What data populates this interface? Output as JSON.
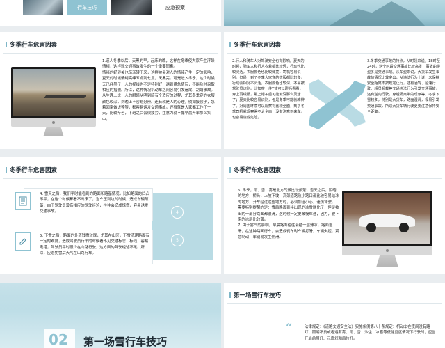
{
  "top_left": {
    "tab_active": "行车技巧",
    "tab_other": "应急预案"
  },
  "slide2": {
    "title": "冬季行车危害因素",
    "paragraph": "1.道人冬季以后，天黑的早，起床的晚，这样在冬季使大家产生浮躁情绪，这样就交通事故发生的一个重要因素。\n情绪的好转关也渐渐转下来，这样被会对人的情绪产生一定的影响，夏天的时候情绪高峰五点到七点，天黑完。可是进入冬季，这个时候天已经黑了，人的视线也不是特别好，遇到紧急情况，不能及时采取相应的措施。所以，这种情况机动车之间容易引发追尾、刮蹭事故。\n从生理上说，人的眼睛从明到暗有个适应的过程，尤其冬季穿的衣服颜色较深，到晚上不容易分辨。还有就是人的心理，例如接孩子，急着回家做饭等等，都容易诱发交通事故。还有就是大家都工作了一天，比较辛苦，下班之后会很疲劳，注意力就不像早晨开车那么集中。"
  },
  "slide3": {
    "title": "冬季行车危害因素",
    "left_text": "2.行人和骑车人对驾驶安全也有影响。夏天的时候，骑车人和行人衣着都比较轻，行动也比较灵活，衣服颜色也比较鲜亮，司机容易识别。但是一到了冬季大家穿的衣服都比较多，行动会相对不灵活，衣服颜色也较深，不易被驾驶员识别。比如穿一件T恤可以蹬后看看，穿上羽绒服，戴上帽子后可能就没那么灵活了；夏天比较容易识别，但是冬季可能就难辨了。对周围环境可以观察得比较全面，到了冬季司机就观察得不太全面，没有注意到来车，也容易造成危险。",
    "right_text": "3.冬季交通事故的特点，从时段来说，18时至24时，这个时段交通事故比较高发，事故的类型多是交通事故。从车型来说，大货车发生事故的情况比较突出，从违法行为上说，未保持安全距离不按规定让行，还有酒驾、超速行驶、超员超载等交通违法行为引发交通事故，还有逆向行驶，穿越隔离带的现象等，冬季下雪较多，特别是大货车，路面湿滑，极易引发交通事故，所以大货车辆行驶更要注意保持安全距离。"
  },
  "slide4": {
    "title": "冬季行车危害因素",
    "item4": "4. 雪天之后，我们平时能看到的路面和路基情况，比如路面的凹凸不平，在这个时候都看不出来了，当车压到坑的时候，造成车辆颠簸，由于驾驶员没有相应的驾驶经验，往往会造成惊慌，容易诱发交通事故。",
    "item5": "5. 下雪之后，路面的外道残雪较厚，尤其在山区，下雪清理路面有一定的难度，造成驾驶员行车的时候看不见交通标志、标线，容易走错，驾驶员平时很少在山路行驶，这方面的驾驶经验不足。所以，应避免雪后天气在山路行车。",
    "num_a": "4",
    "num_b": "5"
  },
  "slide5": {
    "title": "冬季行车危害因素",
    "paragraph": "6. 冬季，雨、雪、雾是北方气候比较频繁，雪天之后，阴暗的地方，桥头，上坡下坡，高架道路及小路口都比较容易结冰的地方，开车经过这些地方时，必须加倍小心，谨慎驾驶。\n需要特别提醒的是：雪后路面到半出现的冰雪融化了，但是被出的一部分路面都很滑，这时候一定要减慢车速，因为，驶下来的冰层比较薄。\n7. 由于雾气的影响，早晨路面往往会结一层薄冰，路面湿滑，在这种路面行车，会造成刹车时车辆打滑，车辆失控，紧急制动，车辆易发生侧滑。"
  },
  "slide6": {
    "number": "02",
    "title": "第一场雪行车技巧"
  },
  "slide7": {
    "title": "第一场雪行车技巧",
    "paragraph": "法律规定：《道路交通安全法》实施条例第八十条规定：机动车在夜间没有路灯、照明不良或者遇有雾、雨、雪、沙尘、冰雹等低能见度情况下行驶时，应当开启前照灯、示廓灯和后位灯。"
  },
  "colors": {
    "accent": "#8fc3d2",
    "accent_dark": "#4d8fa6",
    "text": "#2b2b2b"
  }
}
